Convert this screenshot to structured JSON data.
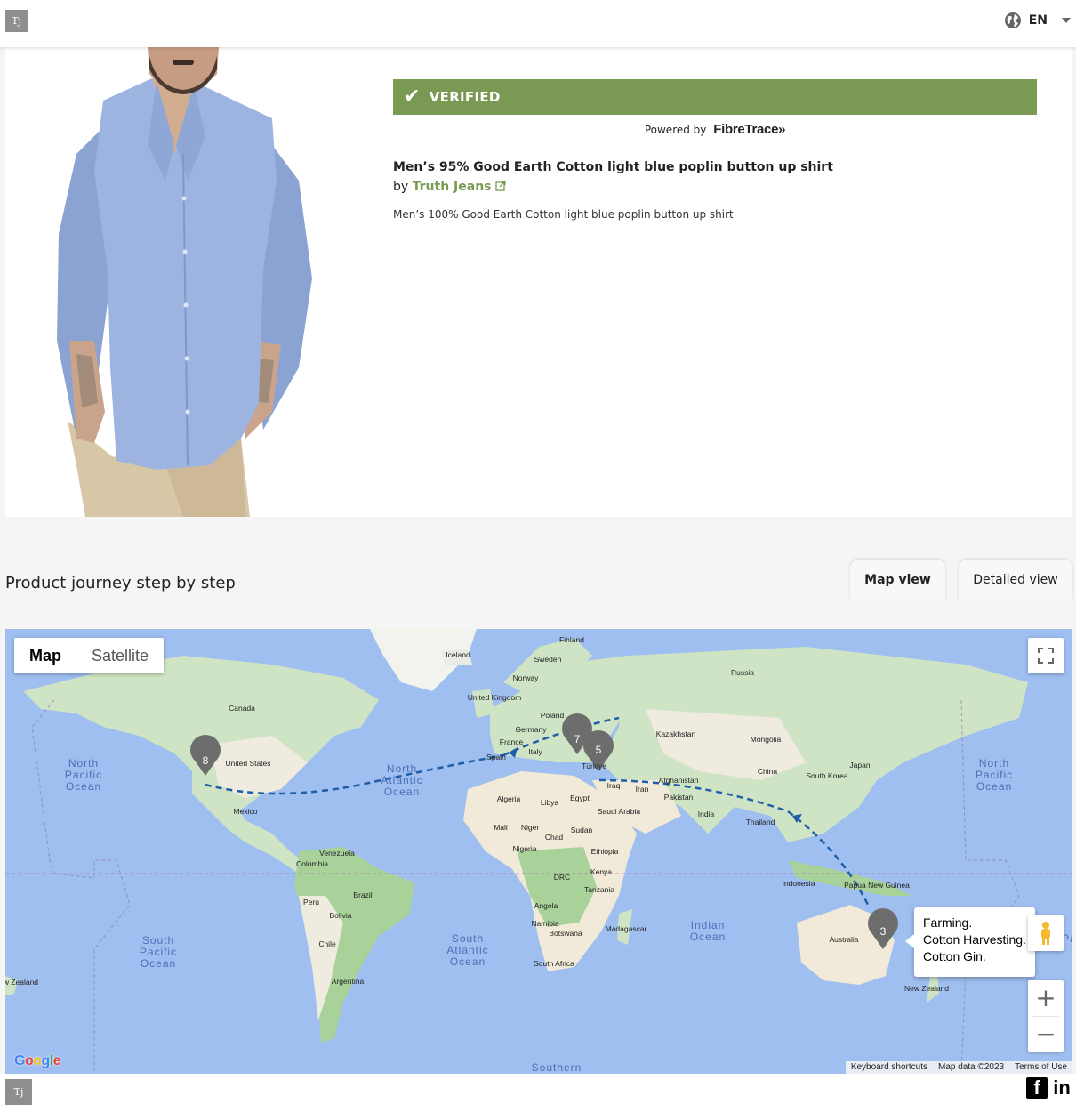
{
  "header": {
    "logo_text": "Tj",
    "language": "EN",
    "icons": {
      "globe": "globe-icon",
      "caret": "caret-down-icon"
    }
  },
  "verification": {
    "status": "VERIFIED",
    "powered_by": "Powered by",
    "provider": "FibreTrace»"
  },
  "product": {
    "title": "Men’s 95% Good Earth Cotton light blue poplin button up shirt",
    "by_label": "by",
    "brand": "Truth Jeans",
    "description": "Men’s 100% Good Earth Cotton light blue poplin button up shirt"
  },
  "journey": {
    "title": "Product journey step by step",
    "tabs": [
      {
        "label": "Map view",
        "active": true
      },
      {
        "label": "Detailed view",
        "active": false
      }
    ]
  },
  "map": {
    "type_toggle": {
      "map": "Map",
      "satellite": "Satellite"
    },
    "markers": [
      "8",
      "7",
      "5",
      "3"
    ],
    "info_window": [
      "Farming.",
      "Cotton Harvesting.",
      "Cotton Gin."
    ],
    "google_logo": "Google",
    "attribution": {
      "shortcuts": "Keyboard shortcuts",
      "data": "Map data ©2023",
      "terms": "Terms of Use"
    },
    "labels": {
      "oceans": {
        "north_pacific_l": [
          "North",
          "Pacific",
          "Ocean"
        ],
        "north_atlantic": [
          "North",
          "Atlantic",
          "Ocean"
        ],
        "north_pacific_r": [
          "North",
          "Pacific",
          "Ocean"
        ],
        "south_pacific": [
          "South",
          "Pacific",
          "Ocean"
        ],
        "south_atlantic": [
          "South",
          "Atlantic",
          "Ocean"
        ],
        "indian": [
          "Indian",
          "Ocean"
        ],
        "southern": "Southern",
        "pacific_edge": "Pac"
      },
      "countries": {
        "iceland": "Iceland",
        "finland": "Finland",
        "sweden": "Sweden",
        "norway": "Norway",
        "russia": "Russia",
        "united_kingdom": "United Kingdom",
        "poland": "Poland",
        "germany": "Germany",
        "france": "France",
        "spain": "Spain",
        "italy": "Italy",
        "turkiye": "Türkiye",
        "kazakhstan": "Kazakhstan",
        "mongolia": "Mongolia",
        "china": "China",
        "japan": "Japan",
        "south_korea": "South Korea",
        "iraq": "Iraq",
        "iran": "Iran",
        "afghanistan": "Afghanistan",
        "pakistan": "Pakistan",
        "india": "India",
        "thailand": "Thailand",
        "canada": "Canada",
        "united_states": "United States",
        "mexico": "Mexico",
        "venezuela": "Venezuela",
        "colombia": "Colombia",
        "peru": "Peru",
        "brazil": "Brazil",
        "bolivia": "Bolivia",
        "chile": "Chile",
        "argentina": "Argentina",
        "algeria": "Algeria",
        "libya": "Libya",
        "egypt": "Egypt",
        "saudi_arabia": "Saudi Arabia",
        "mali": "Mali",
        "niger": "Niger",
        "chad": "Chad",
        "sudan": "Sudan",
        "nigeria": "Nigeria",
        "ethiopia": "Ethiopia",
        "drc": "DRC",
        "kenya": "Kenya",
        "tanzania": "Tanzania",
        "angola": "Angola",
        "namibia": "Namibia",
        "botswana": "Botswana",
        "madagascar": "Madagascar",
        "south_africa": "South Africa",
        "indonesia": "Indonesia",
        "papua_new_guinea": "Papua New Guinea",
        "australia": "Australia",
        "new_zealand_r": "New Zealand",
        "new_zealand_l": "New Zealand"
      }
    }
  },
  "footer": {
    "logo_text": "Tj",
    "social": [
      "f",
      "in"
    ]
  },
  "colors": {
    "verified": "#7a9a53",
    "ocean": "#9fbff0",
    "land": "#d9ead0",
    "route": "#1f5ea8",
    "marker": "#6d6d6d"
  }
}
